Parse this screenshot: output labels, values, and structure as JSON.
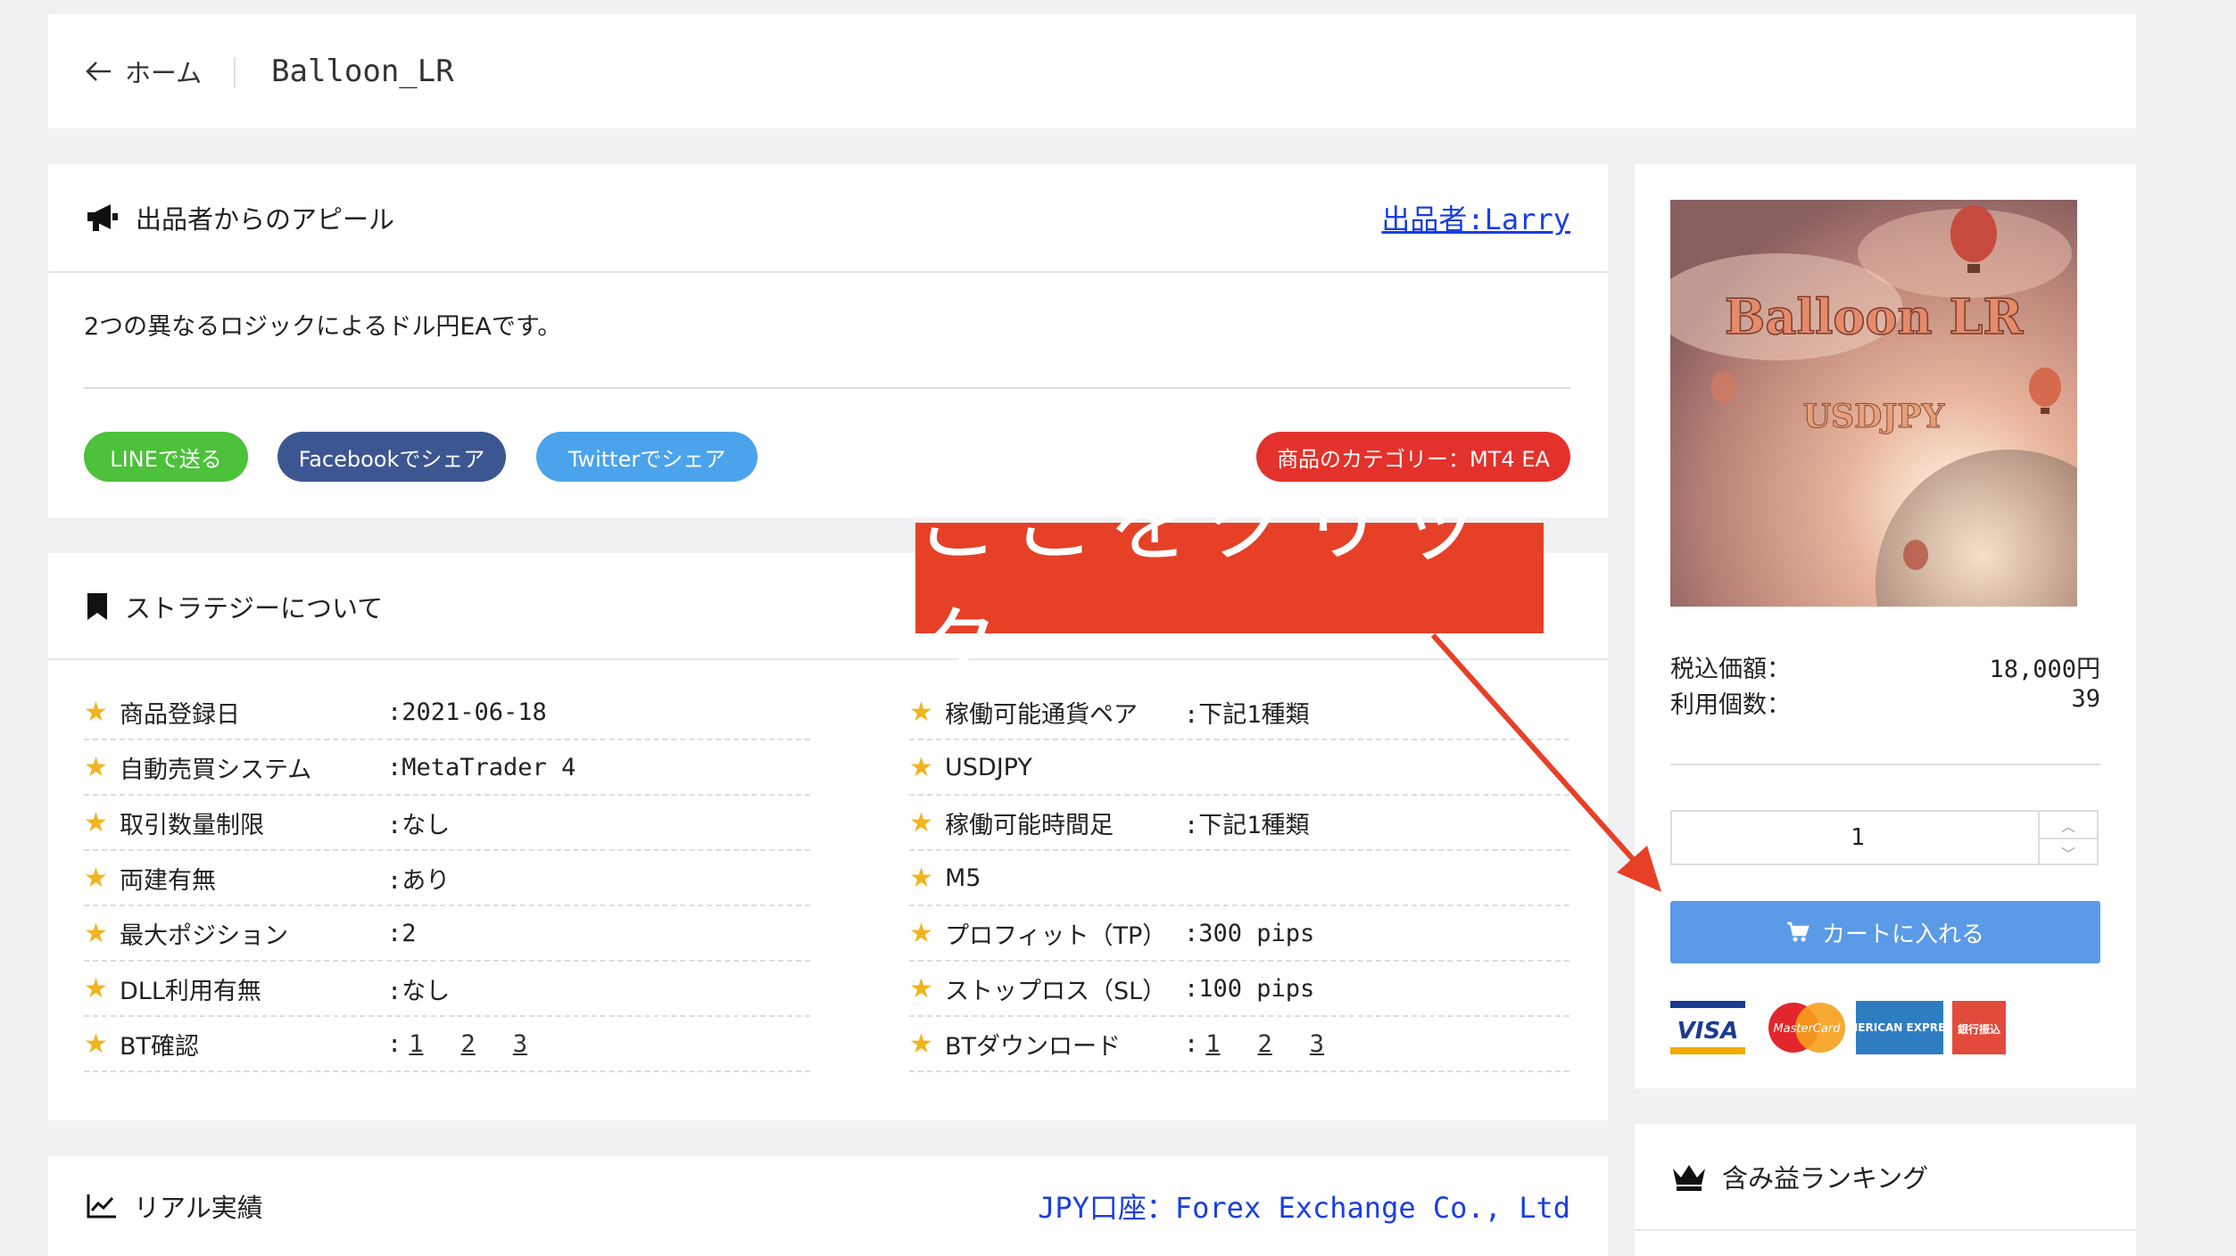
{
  "breadcrumb": {
    "back_label": "ホーム",
    "title": "Balloon_LR"
  },
  "appeal": {
    "heading": "出品者からのアピール",
    "seller_link": "出品者:Larry",
    "description": "2つの異なるロジックによるドル円EAです。",
    "share_line": "LINEで送る",
    "share_facebook": "Facebookでシェア",
    "share_twitter": "Twitterでシェア",
    "category": "商品のカテゴリー：MT4 EA"
  },
  "strategy": {
    "heading": "ストラテジーについて",
    "left": [
      {
        "key": "商品登録日",
        "value": ":2021-06-18"
      },
      {
        "key": "自動売買システム",
        "value": ":MetaTrader 4"
      },
      {
        "key": "取引数量制限",
        "value": ":なし"
      },
      {
        "key": "両建有無",
        "value": ":あり"
      },
      {
        "key": "最大ポジション",
        "value": ":2"
      },
      {
        "key": "DLL利用有無",
        "value": ":なし"
      },
      {
        "key": "BT確認",
        "value": ":",
        "links": [
          "1",
          "2",
          "3"
        ]
      }
    ],
    "right": [
      {
        "key": "稼働可能通貨ペア",
        "value": ":下記1種類"
      },
      {
        "key": "USDJPY",
        "value": ""
      },
      {
        "key": "稼働可能時間足",
        "value": ":下記1種類"
      },
      {
        "key": "M5",
        "value": ""
      },
      {
        "key": "プロフィット（TP）",
        "value": ":300 pips"
      },
      {
        "key": "ストップロス（SL）",
        "value": ":100 pips"
      },
      {
        "key": "BTダウンロード",
        "value": ":",
        "links": [
          "1",
          "2",
          "3"
        ]
      }
    ]
  },
  "real": {
    "heading": "リアル実績",
    "account_link": "JPY口座：Forex Exchange Co., Ltd"
  },
  "product": {
    "image_title": "Balloon LR",
    "image_subtitle": "USDJPY",
    "price_label": "税込価額：",
    "price_value": "18,000円",
    "usage_label": "利用個数：",
    "usage_value": "39",
    "quantity": "1",
    "cart_label": "カートに入れる",
    "payments": [
      "VISA",
      "MasterCard",
      "AMERICAN EXPRESS",
      "銀行振込"
    ]
  },
  "ranking": {
    "heading": "含み益ランキング"
  },
  "annotation": {
    "label": "ここをクリック"
  },
  "colors": {
    "line": "#4cc13a",
    "facebook": "#3c5691",
    "twitter": "#4ba3eb",
    "category": "#e3312b",
    "cart": "#5b9ae6",
    "annotation": "#e64027",
    "link": "#1a3fe0"
  }
}
